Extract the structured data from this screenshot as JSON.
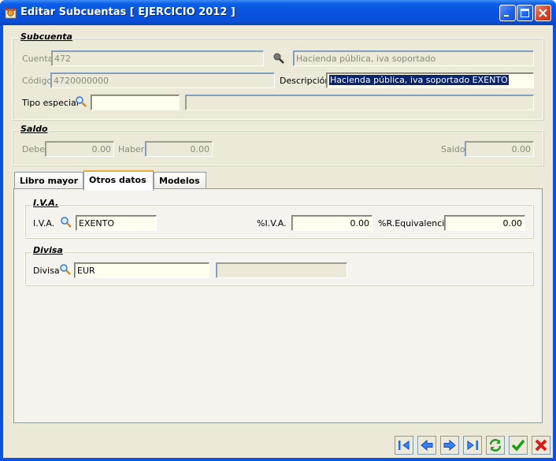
{
  "window": {
    "title": "Editar Subcuentas [ EJERCICIO 2012 ]",
    "colors": {
      "titlebar": "#0a53e0",
      "client": "#ece9d8",
      "editable_bg": "#fffff0",
      "selection": "#0b246a",
      "tab_highlight": "#e5ad3b"
    }
  },
  "subcuenta": {
    "legend": "Subcuenta",
    "cuenta_label": "Cuenta",
    "cuenta_value": "472",
    "cuenta_desc": "Hacienda pública, iva soportado",
    "codigo_label": "Código",
    "codigo_value": "4720000000",
    "descripcion_label": "Descripción",
    "descripcion_value": "Hacienda pública, iva soportado EXENTO",
    "tipo_label": "Tipo especial",
    "tipo_value": "",
    "tipo_desc": ""
  },
  "saldo": {
    "legend": "Saldo",
    "debe_label": "Debe",
    "debe_value": "0.00",
    "haber_label": "Haber",
    "haber_value": "0.00",
    "saldo_label": "Saldo",
    "saldo_value": "0.00"
  },
  "tabs": [
    {
      "label": "Libro mayor",
      "active": false
    },
    {
      "label": "Otros datos",
      "active": true
    },
    {
      "label": "Modelos",
      "active": false
    }
  ],
  "iva": {
    "legend": "I.V.A.",
    "iva_label": "I.V.A.",
    "iva_value": "EXENTO",
    "piva_label": "%I.V.A.",
    "piva_value": "0.00",
    "req_label": "%R.Equivalencia",
    "req_value": "0.00"
  },
  "divisa": {
    "legend": "Divisa",
    "divisa_label": "Divisa",
    "divisa_value": "EUR",
    "divisa_desc": ""
  },
  "icons": {
    "search": "magnifier-icon",
    "first": "first-record-icon",
    "prev": "previous-record-icon",
    "next": "next-record-icon",
    "last": "last-record-icon",
    "refresh": "refresh-icon",
    "accept": "accept-check-icon",
    "cancel": "cancel-x-icon"
  }
}
